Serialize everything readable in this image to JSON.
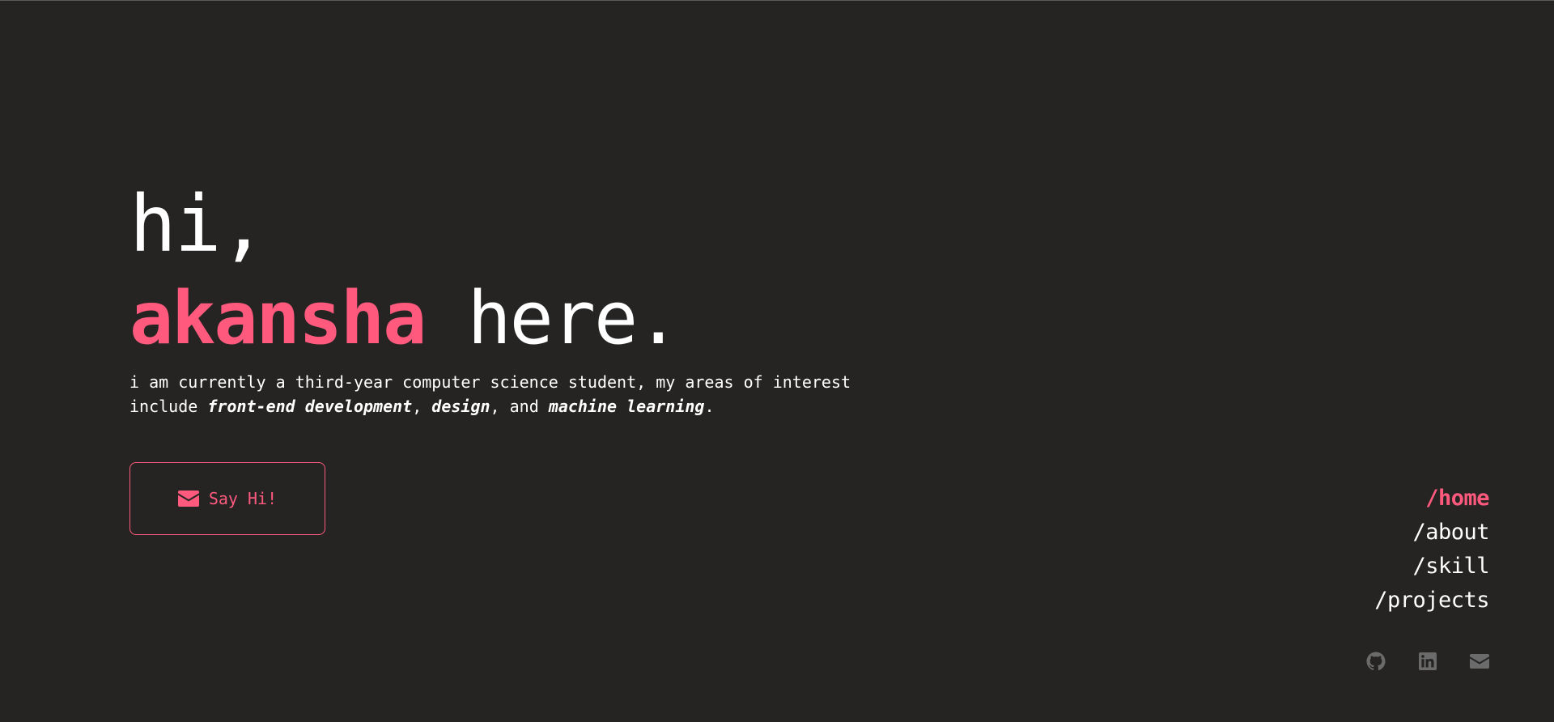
{
  "hero": {
    "greeting": "hi,",
    "name": "akansha",
    "suffix": " here.",
    "intro_prefix": "i am currently a third-year computer science student, my areas of interest include ",
    "interest_1": "front-end development",
    "sep_1": ", ",
    "interest_2": "design",
    "sep_2": ", and ",
    "interest_3": "machine learning",
    "intro_end": "."
  },
  "cta": {
    "icon": "envelope-icon",
    "label": "Say Hi!"
  },
  "nav": {
    "items": [
      {
        "label": "/home",
        "active": true
      },
      {
        "label": "/about",
        "active": false
      },
      {
        "label": "/skill",
        "active": false
      },
      {
        "label": "/projects",
        "active": false
      }
    ]
  },
  "social": {
    "icons": [
      "github-icon",
      "linkedin-icon",
      "envelope-icon"
    ]
  },
  "colors": {
    "background": "#252422",
    "accent": "#ff5a7e",
    "text": "#ffffff",
    "icon_muted": "#6b6b6b"
  }
}
